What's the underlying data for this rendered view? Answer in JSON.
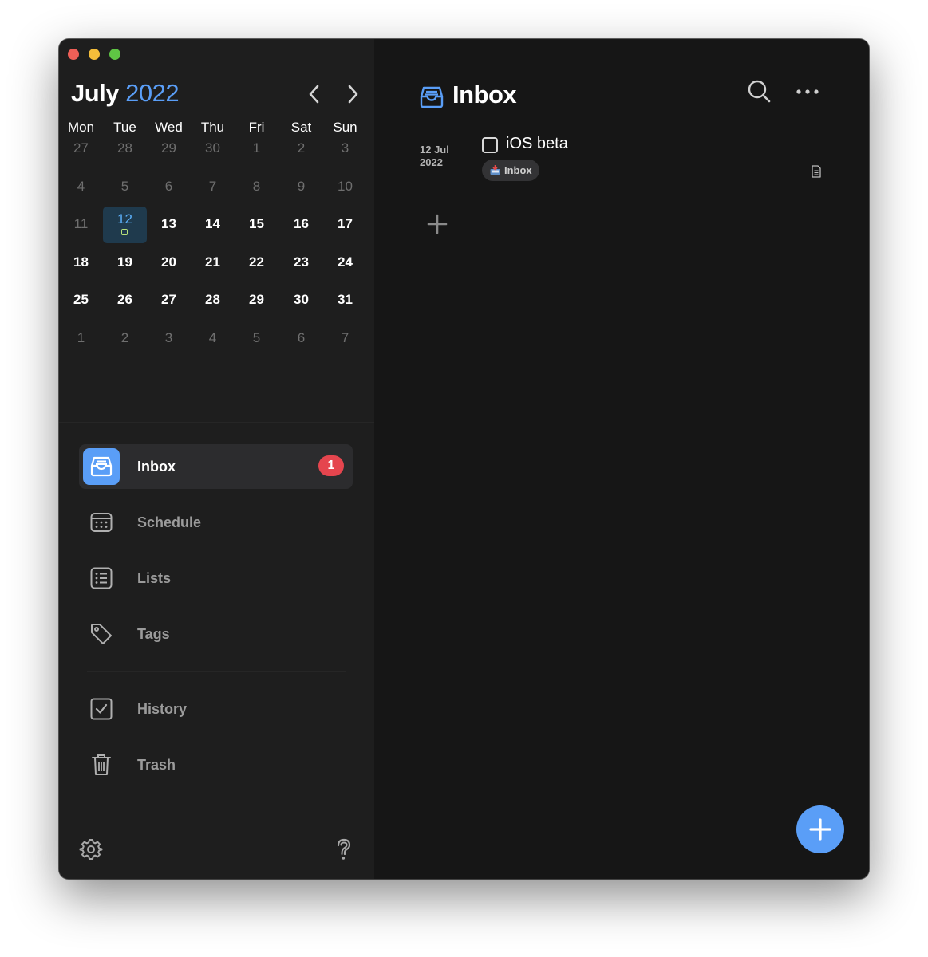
{
  "calendar": {
    "month": "July",
    "year": "2022",
    "weekdays": [
      "Mon",
      "Tue",
      "Wed",
      "Thu",
      "Fri",
      "Sat",
      "Sun"
    ],
    "weeks": [
      [
        {
          "d": "27",
          "s": "dim"
        },
        {
          "d": "28",
          "s": "dim"
        },
        {
          "d": "29",
          "s": "dim"
        },
        {
          "d": "30",
          "s": "dim"
        },
        {
          "d": "1",
          "s": "dim"
        },
        {
          "d": "2",
          "s": "dim"
        },
        {
          "d": "3",
          "s": "dim"
        }
      ],
      [
        {
          "d": "4",
          "s": "dim"
        },
        {
          "d": "5",
          "s": "dim"
        },
        {
          "d": "6",
          "s": "dim"
        },
        {
          "d": "7",
          "s": "dim"
        },
        {
          "d": "8",
          "s": "dim"
        },
        {
          "d": "9",
          "s": "dim"
        },
        {
          "d": "10",
          "s": "dim"
        }
      ],
      [
        {
          "d": "11",
          "s": "dim"
        },
        {
          "d": "12",
          "s": "today"
        },
        {
          "d": "13",
          "s": "bold"
        },
        {
          "d": "14",
          "s": "bold"
        },
        {
          "d": "15",
          "s": "bold"
        },
        {
          "d": "16",
          "s": "bold"
        },
        {
          "d": "17",
          "s": "bold"
        }
      ],
      [
        {
          "d": "18",
          "s": "bold"
        },
        {
          "d": "19",
          "s": "bold"
        },
        {
          "d": "20",
          "s": "bold"
        },
        {
          "d": "21",
          "s": "bold"
        },
        {
          "d": "22",
          "s": "bold"
        },
        {
          "d": "23",
          "s": "bold"
        },
        {
          "d": "24",
          "s": "bold"
        }
      ],
      [
        {
          "d": "25",
          "s": "bold"
        },
        {
          "d": "26",
          "s": "bold"
        },
        {
          "d": "27",
          "s": "bold"
        },
        {
          "d": "28",
          "s": "bold"
        },
        {
          "d": "29",
          "s": "bold"
        },
        {
          "d": "30",
          "s": "bold"
        },
        {
          "d": "31",
          "s": "bold"
        }
      ],
      [
        {
          "d": "1",
          "s": "dim"
        },
        {
          "d": "2",
          "s": "dim"
        },
        {
          "d": "3",
          "s": "dim"
        },
        {
          "d": "4",
          "s": "dim"
        },
        {
          "d": "5",
          "s": "dim"
        },
        {
          "d": "6",
          "s": "dim"
        },
        {
          "d": "7",
          "s": "dim"
        }
      ]
    ]
  },
  "sidebar": {
    "items": [
      {
        "label": "Inbox",
        "icon": "inbox-tray-icon",
        "active": true,
        "badge": "1"
      },
      {
        "label": "Schedule",
        "icon": "calendar-icon"
      },
      {
        "label": "Lists",
        "icon": "list-icon"
      },
      {
        "label": "Tags",
        "icon": "tag-icon"
      },
      {
        "label": "History",
        "icon": "checkbox-icon"
      },
      {
        "label": "Trash",
        "icon": "trash-icon"
      }
    ]
  },
  "main": {
    "title": "Inbox",
    "task": {
      "date_line1": "12 Jul",
      "date_line2": "2022",
      "title": "iOS beta",
      "tag": "Inbox",
      "completed": false
    }
  },
  "colors": {
    "accent": "#5a9ef7",
    "badge": "#e5454e",
    "today_bg": "#1f3a4d",
    "sidebar_bg": "#1e1e1e",
    "main_bg": "#161616"
  }
}
